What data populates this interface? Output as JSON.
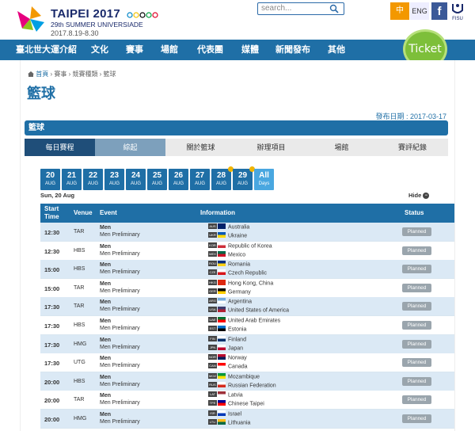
{
  "header": {
    "logo_title": "TAIPEI 2017",
    "logo_subtitle": "29th SUMMER UNIVERSIADE",
    "logo_dates": "2017.8.19-8.30",
    "search_placeholder": "search...",
    "lang_zh": "中",
    "lang_en": "ENG",
    "fb": "f",
    "fisu": "FISU"
  },
  "nav": {
    "items": [
      "臺北世大運介紹",
      "文化",
      "賽事",
      "場館",
      "代表團",
      "媒體",
      "新聞發布",
      "其他"
    ],
    "ticket": "Ticket"
  },
  "breadcrumb": {
    "home": "首頁",
    "rest": " › 賽事 › 競賽種類 › 籃球"
  },
  "page": {
    "title": "籃球",
    "published": "發布日期 : 2017-03-17",
    "section_title": "籃球"
  },
  "tabs": [
    "每日賽程",
    "綜起",
    "關於籃球",
    "辦理項目",
    "場館",
    "賽評紀錄"
  ],
  "dates": [
    {
      "day": "20",
      "month": "AUG",
      "dot": false
    },
    {
      "day": "21",
      "month": "AUG",
      "dot": false
    },
    {
      "day": "22",
      "month": "AUG",
      "dot": false
    },
    {
      "day": "23",
      "month": "AUG",
      "dot": false
    },
    {
      "day": "24",
      "month": "AUG",
      "dot": false
    },
    {
      "day": "25",
      "month": "AUG",
      "dot": false
    },
    {
      "day": "26",
      "month": "AUG",
      "dot": false
    },
    {
      "day": "27",
      "month": "AUG",
      "dot": false
    },
    {
      "day": "28",
      "month": "AUG",
      "dot": true
    },
    {
      "day": "29",
      "month": "AUG",
      "dot": true
    },
    {
      "day": "All",
      "month": "Days",
      "dot": false
    }
  ],
  "schedule": {
    "day_label": "Sun, 20 Aug",
    "hide_label": "Hide",
    "columns": {
      "start_time": "Start Time",
      "venue": "Venue",
      "event": "Event",
      "information": "Information",
      "status": "Status"
    },
    "rows": [
      {
        "time": "12:30",
        "venue": "TAR",
        "event1": "Men",
        "event2": "Men Preliminary",
        "team1": "Australia",
        "code1": "AUS",
        "team2": "Ukraine",
        "code2": "UKR",
        "status": "Planned",
        "c1": [
          "#012169",
          "#012169"
        ],
        "c2": [
          "#0057b7",
          "#ffd700"
        ]
      },
      {
        "time": "12:30",
        "venue": "HBS",
        "event1": "Men",
        "event2": "Men Preliminary",
        "team1": "Republic of Korea",
        "code1": "KOR",
        "team2": "Mexico",
        "code2": "MEX",
        "status": "Planned",
        "c1": [
          "#ffffff",
          "#cd2e3a"
        ],
        "c2": [
          "#006847",
          "#ce1126"
        ]
      },
      {
        "time": "15:00",
        "venue": "HBS",
        "event1": "Men",
        "event2": "Men Preliminary",
        "team1": "Romania",
        "code1": "ROU",
        "team2": "Czech Republic",
        "code2": "CZE",
        "status": "Planned",
        "c1": [
          "#002b7f",
          "#fcd116"
        ],
        "c2": [
          "#ffffff",
          "#d7141a"
        ]
      },
      {
        "time": "15:00",
        "venue": "TAR",
        "event1": "Men",
        "event2": "Men Preliminary",
        "team1": "Hong Kong, China",
        "code1": "HKG",
        "team2": "Germany",
        "code2": "GER",
        "status": "Planned",
        "c1": [
          "#de2910",
          "#de2910"
        ],
        "c2": [
          "#000000",
          "#ffce00"
        ]
      },
      {
        "time": "17:30",
        "venue": "TAR",
        "event1": "Men",
        "event2": "Men Preliminary",
        "team1": "Argentina",
        "code1": "ARG",
        "team2": "United States of America",
        "code2": "USA",
        "status": "Planned",
        "c1": [
          "#74acdf",
          "#ffffff"
        ],
        "c2": [
          "#3c3b6e",
          "#b22234"
        ]
      },
      {
        "time": "17:30",
        "venue": "HBS",
        "event1": "Men",
        "event2": "Men Preliminary",
        "team1": "United Arab Emirates",
        "code1": "UAE",
        "team2": "Estonia",
        "code2": "EST",
        "status": "Planned",
        "c1": [
          "#00732f",
          "#ff0000"
        ],
        "c2": [
          "#0072ce",
          "#000000"
        ]
      },
      {
        "time": "17:30",
        "venue": "HMG",
        "event1": "Men",
        "event2": "Men Preliminary",
        "team1": "Finland",
        "code1": "FIN",
        "team2": "Japan",
        "code2": "JPN",
        "status": "Planned",
        "c1": [
          "#ffffff",
          "#002f6c"
        ],
        "c2": [
          "#ffffff",
          "#bc002d"
        ]
      },
      {
        "time": "17:30",
        "venue": "UTG",
        "event1": "Men",
        "event2": "Men Preliminary",
        "team1": "Norway",
        "code1": "NOR",
        "team2": "Canada",
        "code2": "CAN",
        "status": "Planned",
        "c1": [
          "#ba0c2f",
          "#00205b"
        ],
        "c2": [
          "#ff0000",
          "#ffffff"
        ]
      },
      {
        "time": "20:00",
        "venue": "HBS",
        "event1": "Men",
        "event2": "Men Preliminary",
        "team1": "Mozambique",
        "code1": "MOZ",
        "team2": "Russian Federation",
        "code2": "RUS",
        "status": "Planned",
        "c1": [
          "#009739",
          "#fce100"
        ],
        "c2": [
          "#ffffff",
          "#d52b1e"
        ]
      },
      {
        "time": "20:00",
        "venue": "TAR",
        "event1": "Men",
        "event2": "Men Preliminary",
        "team1": "Latvia",
        "code1": "LAT",
        "team2": "Chinese Taipei",
        "code2": "TPE",
        "status": "Planned",
        "c1": [
          "#9e3039",
          "#ffffff"
        ],
        "c2": [
          "#000095",
          "#fe0000"
        ]
      },
      {
        "time": "20:00",
        "venue": "HMG",
        "event1": "Men",
        "event2": "Men Preliminary",
        "team1": "Israel",
        "code1": "ISR",
        "team2": "Lithuania",
        "code2": "LTU",
        "status": "Planned",
        "c1": [
          "#ffffff",
          "#0038b8"
        ],
        "c2": [
          "#fdb913",
          "#006a44"
        ]
      }
    ]
  },
  "colors": {
    "primary": "#1f6fa6",
    "dark_tab": "#1f4e79",
    "ticket_green": "#7dbf3a",
    "lang_orange": "#f39800",
    "status_grey": "#9aa5ad"
  }
}
